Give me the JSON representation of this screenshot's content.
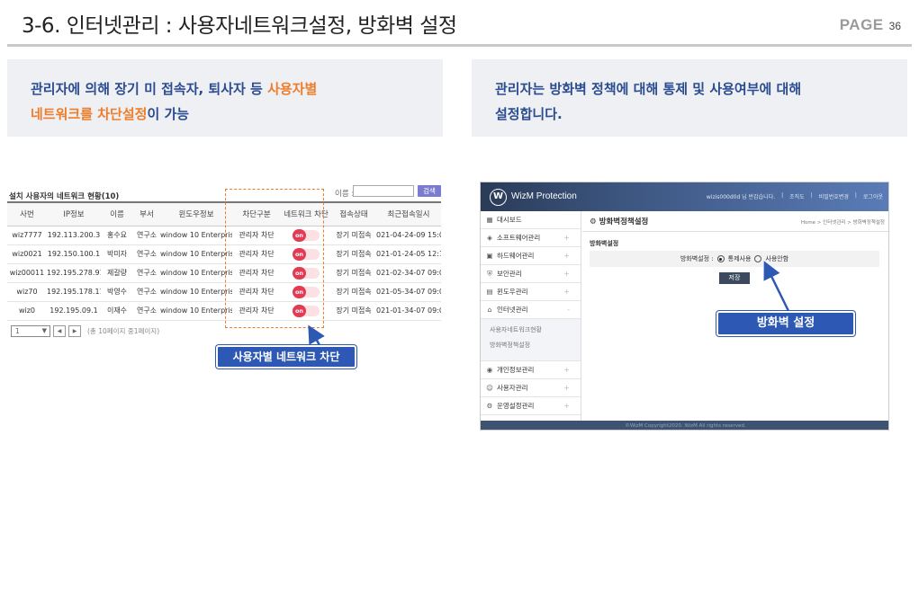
{
  "header": {
    "title": "3-6. 인터넷관리 : 사용자네트워크설정, 방화벽 설정",
    "page_label": "PAGE",
    "page_number": "36"
  },
  "info_left": {
    "part1": "관리자에 의해 장기 미 접속자, 퇴사자 등 ",
    "part2": "사용자별",
    "part3": "네트워크를 차단설정",
    "part4": "이 가능"
  },
  "info_right": {
    "line1": "관리자는 방화벽 정책에 대해 통제 및 사용여부에 대해",
    "line2": "설정합니다."
  },
  "user_table": {
    "title": "설치 사용자의 네트워크 현황(10)",
    "search_label": "이름 :",
    "search_value": "",
    "search_button": "검색",
    "columns": [
      "사번",
      "IP정보",
      "이름",
      "부서",
      "윈도우정보",
      "차단구분",
      "네트워크 차단",
      "접속상태",
      "최근접속일시"
    ],
    "rows": [
      {
        "id": "wiz7777",
        "ip": "192.113.200.3",
        "name": "홍수요",
        "dept": "연구소",
        "os": "window 10 Enterprise",
        "block_type": "관리자 차단",
        "toggle": "on",
        "status": "장기 미접속",
        "last": "021-04-24-09 15:00"
      },
      {
        "id": "wiz0021",
        "ip": "192.150.100.1",
        "name": "박미자",
        "dept": "연구소",
        "os": "window 10 Enterprise",
        "block_type": "관리자 차단",
        "toggle": "on",
        "status": "장기 미접속",
        "last": "021-01-24-05 12:10"
      },
      {
        "id": "wiz00011",
        "ip": "192.195.278.91",
        "name": "제갈량",
        "dept": "연구소",
        "os": "window 10 Enterprise",
        "block_type": "관리자 차단",
        "toggle": "on",
        "status": "장기 미접속",
        "last": "021-02-34-07 09:00"
      },
      {
        "id": "wiz70",
        "ip": "192.195.178.11",
        "name": "박영수",
        "dept": "연구소",
        "os": "window 10 Enterprise",
        "block_type": "관리자 차단",
        "toggle": "on",
        "status": "장기 미접속",
        "last": "021-05-34-07 09:00"
      },
      {
        "id": "wiz0",
        "ip": "192.195.09.1",
        "name": "이재수",
        "dept": "연구소",
        "os": "window 10 Enterprise",
        "block_type": "관리자 차단",
        "toggle": "on",
        "status": "장기 미접속",
        "last": "021-01-34-07 09:00"
      }
    ],
    "pager_select": "1",
    "pager_info": "(총 10페이지 중1페이지)"
  },
  "callout_left": "사용자별 네트워크 차단",
  "callout_right": "방화벽 설정",
  "wizm": {
    "brand": "WizM Protection",
    "topnav": [
      "wizis000d0d 님 반갑습니다.",
      "|",
      "조직도",
      "|",
      "비밀번호변경",
      "|",
      "로그아웃"
    ],
    "menu": [
      {
        "label": "대시보드",
        "icon": "dashboard-icon",
        "plus": ""
      },
      {
        "label": "소프트웨어관리",
        "icon": "software-icon",
        "plus": "+"
      },
      {
        "label": "하드웨어관리",
        "icon": "hardware-icon",
        "plus": "+"
      },
      {
        "label": "보안관리",
        "icon": "security-icon",
        "plus": "+"
      },
      {
        "label": "윈도우관리",
        "icon": "window-icon",
        "plus": "+"
      },
      {
        "label": "인터넷관리",
        "icon": "network-icon",
        "plus": "-"
      }
    ],
    "submenu": [
      "사용자네트워크현황",
      "방화벽정책설정"
    ],
    "menu_after": [
      {
        "label": "개인정보관리",
        "icon": "privacy-icon",
        "plus": "+"
      },
      {
        "label": "사용자관리",
        "icon": "user-icon",
        "plus": "+"
      },
      {
        "label": "운영설정관리",
        "icon": "settings-icon",
        "plus": "+"
      }
    ],
    "main_title": "방화벽정책설정",
    "breadcrumb": "Home > 인터넷관리 > 방화벽정책설정",
    "section_label": "방화벽설정",
    "field_label": "방화벽설정 :",
    "option_on": "통제사용",
    "option_off": "사용안함",
    "save_button": "저장",
    "footer": "©WizM Copyright2020. WizM All rights reserved."
  }
}
